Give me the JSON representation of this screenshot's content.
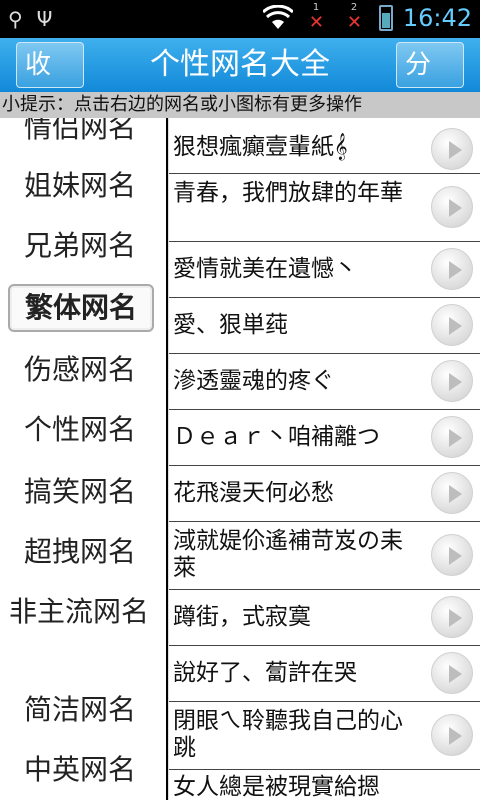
{
  "status_bar": {
    "time": "16:42",
    "sim1": "1",
    "sim2": "2",
    "icons": [
      "usb-debug-icon",
      "usb-icon",
      "wifi-icon",
      "no-signal-icon",
      "battery-charging-icon"
    ]
  },
  "title_bar": {
    "left_button": "收藏",
    "title": "个性网名大全",
    "right_button": "分享",
    "accent_color": "#1a93e0"
  },
  "hint": "小提示：点击右边的网名或小图标有更多操作",
  "categories": [
    {
      "label": "情侣网名"
    },
    {
      "label": "姐妹网名"
    },
    {
      "label": "兄弟网名"
    },
    {
      "label": "繁体网名",
      "selected": true
    },
    {
      "label": "伤感网名"
    },
    {
      "label": "个性网名"
    },
    {
      "label": "搞笑网名"
    },
    {
      "label": "超拽网名"
    },
    {
      "label": "非主流网名"
    },
    {
      "label": "简洁网名"
    },
    {
      "label": "中英网名"
    }
  ],
  "names": [
    "狠想瘋癲壹輩紙𝄞",
    "青春，我們放肆的年華",
    "愛情就美在遺憾丶",
    "愛、狠単莼",
    "滲透靈魂的疼ぐ",
    "Ｄｅａｒ丶咱補離つ",
    "花飛漫天何必愁",
    "淢就媞伱遙補苛岌の耒萊",
    "蹲街，式寂寞",
    "說好了、蔔許在哭",
    "閉眼ㄟ聆聽我自己的心跳",
    "女人總是被現實給摁"
  ]
}
